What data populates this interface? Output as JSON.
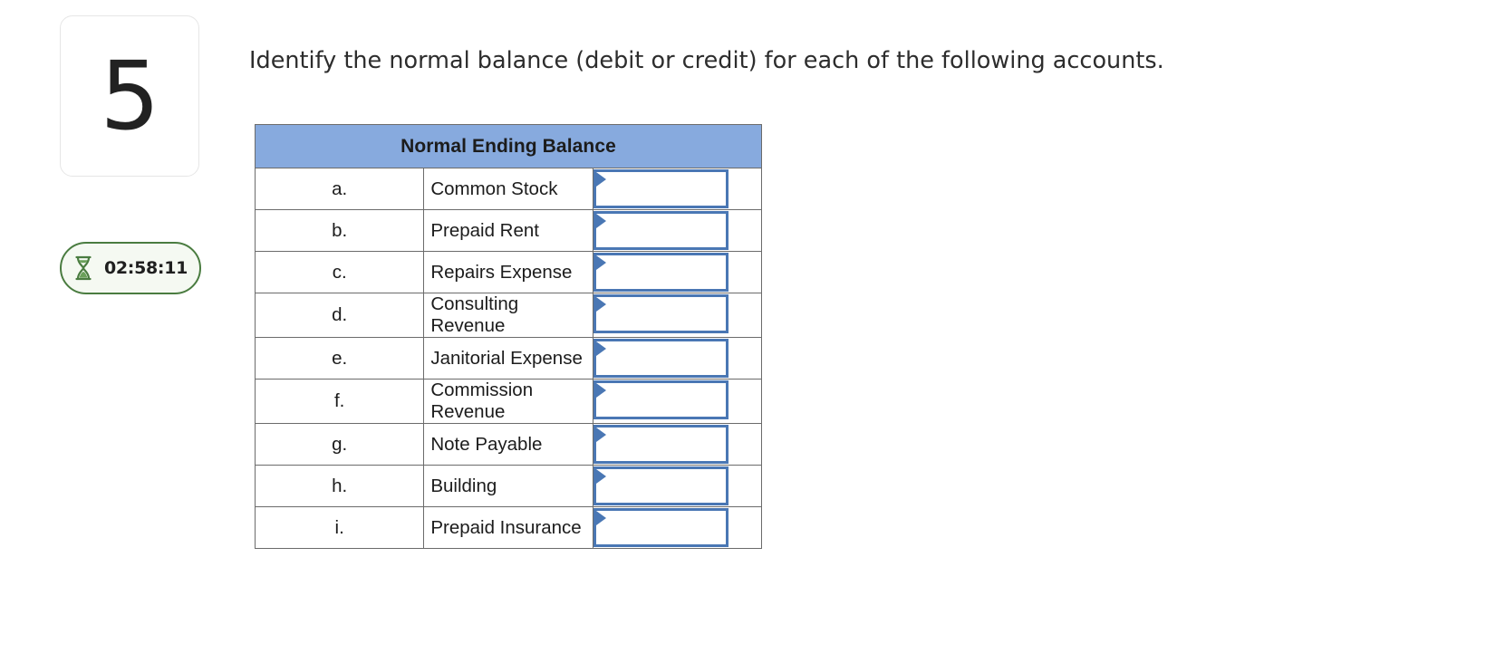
{
  "question": {
    "number": "5",
    "prompt": "Identify the normal balance (debit or credit) for each of the following accounts."
  },
  "timer": {
    "icon": "hourglass-icon",
    "value": "02:58:11",
    "border_color": "#4a7c40",
    "background_color": "#f5f9f2"
  },
  "table": {
    "header": "Normal Ending Balance",
    "header_bg": "#87aade",
    "border_color": "#6b6b6b",
    "select_border_color": "#4a77b4",
    "rows": [
      {
        "letter": "a.",
        "account": "Common Stock",
        "answer": ""
      },
      {
        "letter": "b.",
        "account": "Prepaid Rent",
        "answer": ""
      },
      {
        "letter": "c.",
        "account": "Repairs Expense",
        "answer": ""
      },
      {
        "letter": "d.",
        "account": "Consulting Revenue",
        "answer": ""
      },
      {
        "letter": "e.",
        "account": "Janitorial Expense",
        "answer": ""
      },
      {
        "letter": "f.",
        "account": "Commission Revenue",
        "answer": ""
      },
      {
        "letter": "g.",
        "account": "Note Payable",
        "answer": ""
      },
      {
        "letter": "h.",
        "account": "Building",
        "answer": ""
      },
      {
        "letter": "i.",
        "account": "Prepaid Insurance",
        "answer": ""
      }
    ]
  }
}
